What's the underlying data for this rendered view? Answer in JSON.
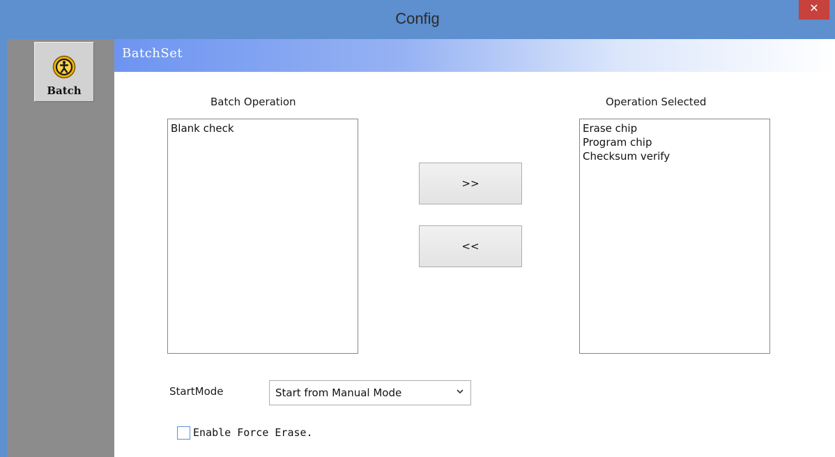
{
  "window": {
    "title": "Config",
    "close_glyph": "✕"
  },
  "sidebar": {
    "items": [
      {
        "label": "Batch",
        "icon": "batch-person-icon"
      }
    ]
  },
  "panel": {
    "header": "BatchSet",
    "batch_operation": {
      "label": "Batch Operation",
      "items": [
        "Blank check"
      ]
    },
    "operation_selected": {
      "label": "Operation Selected",
      "items": [
        "Erase chip",
        "Program chip",
        "Checksum verify"
      ]
    },
    "add_button": ">>",
    "remove_button": "<<",
    "start_mode": {
      "label": "StartMode",
      "value": "Start from Manual Mode"
    },
    "force_erase": {
      "label": "Enable Force Erase.",
      "checked": false
    }
  },
  "colors": {
    "titlebar": "#5e8fcf",
    "close": "#c7413d",
    "sidebar": "#8c8c8c",
    "header_start": "#6d94f1"
  }
}
